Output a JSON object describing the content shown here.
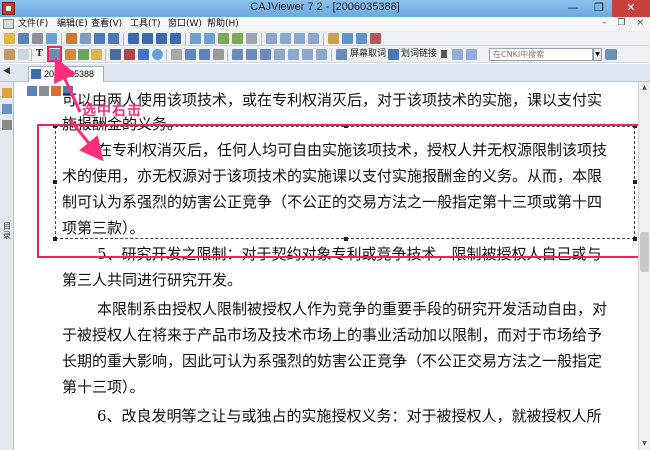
{
  "window": {
    "title": "CAJViewer 7.2 - [2006035388]",
    "min_glyph": "—",
    "max_glyph": "❐",
    "close_glyph": "✕"
  },
  "menu": {
    "items": [
      "文件(F)",
      "编辑(E)",
      "查看(V)",
      "工具(T)",
      "窗口(W)",
      "帮助(H)"
    ],
    "right_buttons": "– ❐ ×"
  },
  "toolbar2": {
    "screen_capture_label": "屏幕取词",
    "link_label": "划词链接",
    "search_placeholder": "在CNKI中搜索",
    "text_tool_glyph": "T"
  },
  "tab": {
    "left_arrow": "◀",
    "doc_label": "2006035388"
  },
  "sidebar": {
    "vertical_label": "目录"
  },
  "scrollbar": {
    "up": "▲",
    "down": "▼"
  },
  "annotation": {
    "label": "选中右击",
    "color": "#ff2d7a"
  },
  "document": {
    "lines": [
      "可以由两人使用该项技术，或在专利权消灭后，对于该项技术的实施，课以支付实",
      "施报酬金的义务。",
      "在专利权消灭后，任何人均可自由实施该项技术，授权人并无权源限制该项技",
      "术的使用，亦无权源对于该项技术的实施课以支付实施报酬金的义务。从而，本限",
      "制可认为系强烈的妨害公正竞争（不公正的交易方法之一般指定第十三项或第十四",
      "项第三款）。",
      "5、研究开发之限制：对于契约对象专利或竞争技术，限制被授权人自己或与",
      "第三人共同进行研究开发。",
      "本限制系由授权人限制被授权人作为竞争的重要手段的研究开发活动自由，对",
      "于被授权人在将来于产品市场及技术市场上的事业活动加以限制，而对于市场给予",
      "长期的重大影响，因此可认为系强烈的妨害公正竞争（不公正交易方法之一般指定",
      "第十三项）。",
      "6、改良发明等之让与或独占的实施授权义务：对于被授权人，就被授权人所"
    ]
  },
  "colors": {
    "highlight": "#e8285a",
    "titlebar": "#7fb6e6"
  }
}
